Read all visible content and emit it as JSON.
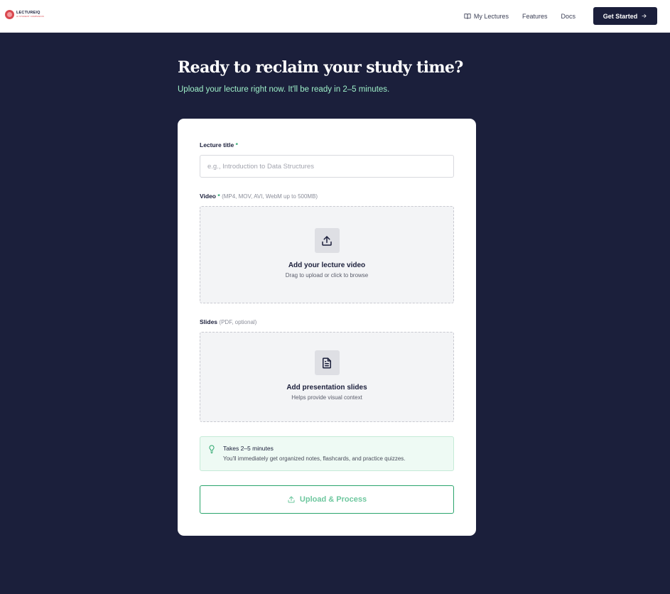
{
  "nav": {
    "logo_name": "LECTUREIQ",
    "logo_tagline": "AI STUDENT COMPANION",
    "links": [
      {
        "label": "My Lectures",
        "icon": "book-icon"
      },
      {
        "label": "Features"
      },
      {
        "label": "Docs"
      }
    ],
    "cta_label": "Get Started",
    "cta_icon": "arrow-right-icon"
  },
  "hero": {
    "title": "Ready to reclaim your study time?",
    "subtitle": "Upload your lecture right now. It'll be ready in 2–5 minutes."
  },
  "form": {
    "title_field": {
      "label": "Lecture title",
      "required_mark": "*",
      "placeholder": "e.g., Introduction to Data Structures",
      "value": ""
    },
    "video": {
      "label": "Video",
      "required_mark": "*",
      "hint": "(MP4, MOV, AVI, WebM up to 500MB)",
      "icon": "upload-icon",
      "title": "Add your lecture video",
      "subtitle": "Drag to upload or click to browse"
    },
    "slides": {
      "label": "Slides",
      "hint": "(PDF, optional)",
      "icon": "document-icon",
      "title": "Add presentation slides",
      "subtitle": "Helps provide visual context"
    },
    "tip": {
      "icon": "lightbulb-icon",
      "title": "Takes 2–5 minutes",
      "text": "You'll immediately get organized notes, flashcards, and practice quizzes."
    },
    "submit_label": "Upload & Process",
    "submit_icon": "upload-icon"
  },
  "colors": {
    "background": "#1b1f3b",
    "accent_green": "#2aa56c",
    "subtitle_green": "#9ef0c9",
    "logo_red": "#d9484f"
  }
}
